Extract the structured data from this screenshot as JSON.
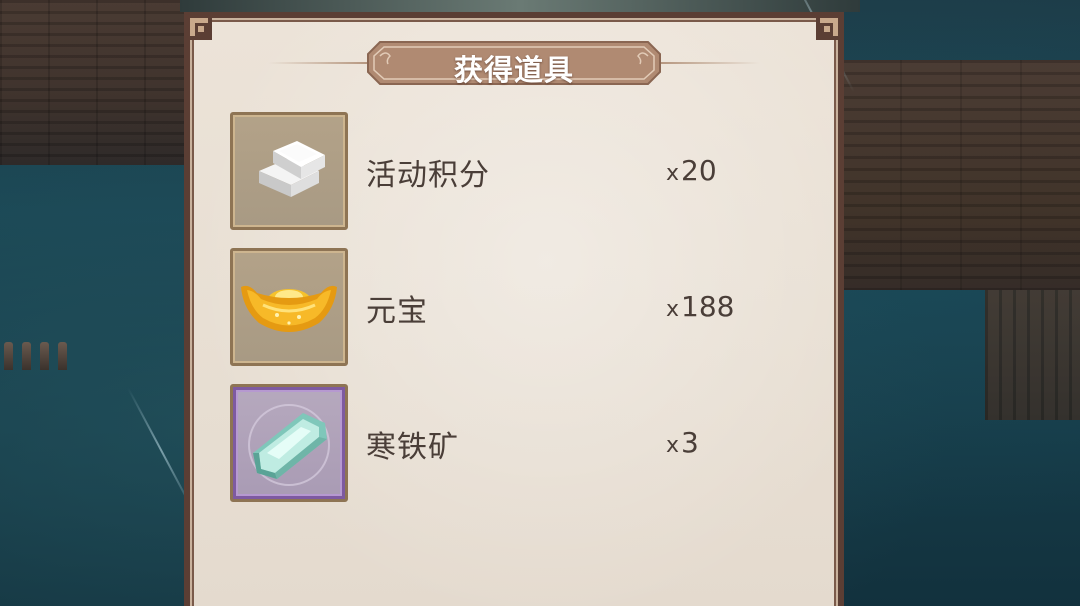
{
  "panel": {
    "title": "获得道具"
  },
  "items": [
    {
      "name": "活动积分",
      "count_prefix": "x",
      "count": "20",
      "icon": "silver-ingot-icon",
      "rarity": "common"
    },
    {
      "name": "元宝",
      "count_prefix": "x",
      "count": "188",
      "icon": "gold-yuanbao-icon",
      "rarity": "common"
    },
    {
      "name": "寒铁矿",
      "count_prefix": "x",
      "count": "3",
      "icon": "cold-iron-ore-icon",
      "rarity": "epic"
    }
  ],
  "colors": {
    "panel_bg": "#e8dfd3",
    "panel_border": "#5b3e34",
    "title_plate": "#b08a72",
    "text": "#4a3e38",
    "epic_border": "#7e5aa1"
  }
}
